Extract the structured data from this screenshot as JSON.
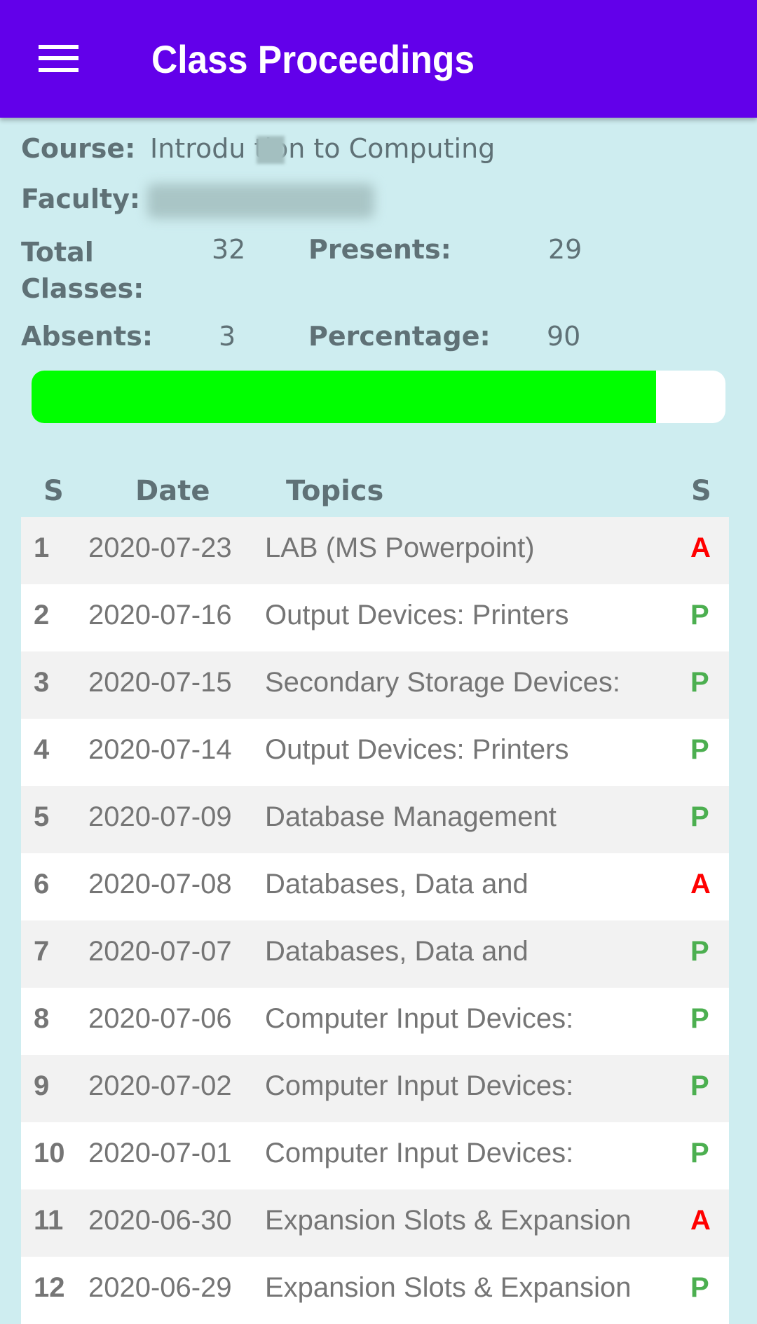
{
  "appbar": {
    "title": "Class Proceedings",
    "menu_icon": "hamburger-menu-icon"
  },
  "info": {
    "course_label": "Course:",
    "course_value": "Introdu  tion to Computing",
    "faculty_label": "Faculty:",
    "faculty_value": "",
    "total_label": "Total Classes:",
    "total_value": "32",
    "presents_label": "Presents:",
    "presents_value": "29",
    "absents_label": "Absents:",
    "absents_value": "3",
    "percentage_label": "Percentage:",
    "percentage_value": "90"
  },
  "progress": {
    "percent": 90,
    "fill_color": "#00ff00",
    "track_color": "#ffffff"
  },
  "table": {
    "headers": [
      "S",
      "Date",
      "Topics",
      "S"
    ],
    "status_colors": {
      "A": "#ff0000",
      "P": "#4caf50"
    },
    "rows": [
      {
        "sn": "1",
        "date": "2020-07-23",
        "topic": "LAB (MS Powerpoint)",
        "status": "A"
      },
      {
        "sn": "2",
        "date": "2020-07-16",
        "topic": "Output Devices: Printers",
        "status": "P"
      },
      {
        "sn": "3",
        "date": "2020-07-15",
        "topic": "Secondary Storage Devices:",
        "status": "P"
      },
      {
        "sn": "4",
        "date": "2020-07-14",
        "topic": "Output Devices: Printers",
        "status": "P"
      },
      {
        "sn": "5",
        "date": "2020-07-09",
        "topic": "Database Management",
        "status": "P"
      },
      {
        "sn": "6",
        "date": "2020-07-08",
        "topic": "Databases, Data and",
        "status": "A"
      },
      {
        "sn": "7",
        "date": "2020-07-07",
        "topic": "Databases, Data and",
        "status": "P"
      },
      {
        "sn": "8",
        "date": "2020-07-06",
        "topic": "Computer Input Devices:",
        "status": "P"
      },
      {
        "sn": "9",
        "date": "2020-07-02",
        "topic": "Computer Input Devices:",
        "status": "P"
      },
      {
        "sn": "10",
        "date": "2020-07-01",
        "topic": "Computer Input Devices:",
        "status": "P"
      },
      {
        "sn": "11",
        "date": "2020-06-30",
        "topic": "Expansion Slots & Expansion",
        "status": "A"
      },
      {
        "sn": "12",
        "date": "2020-06-29",
        "topic": "Expansion Slots & Expansion",
        "status": "P"
      }
    ]
  }
}
